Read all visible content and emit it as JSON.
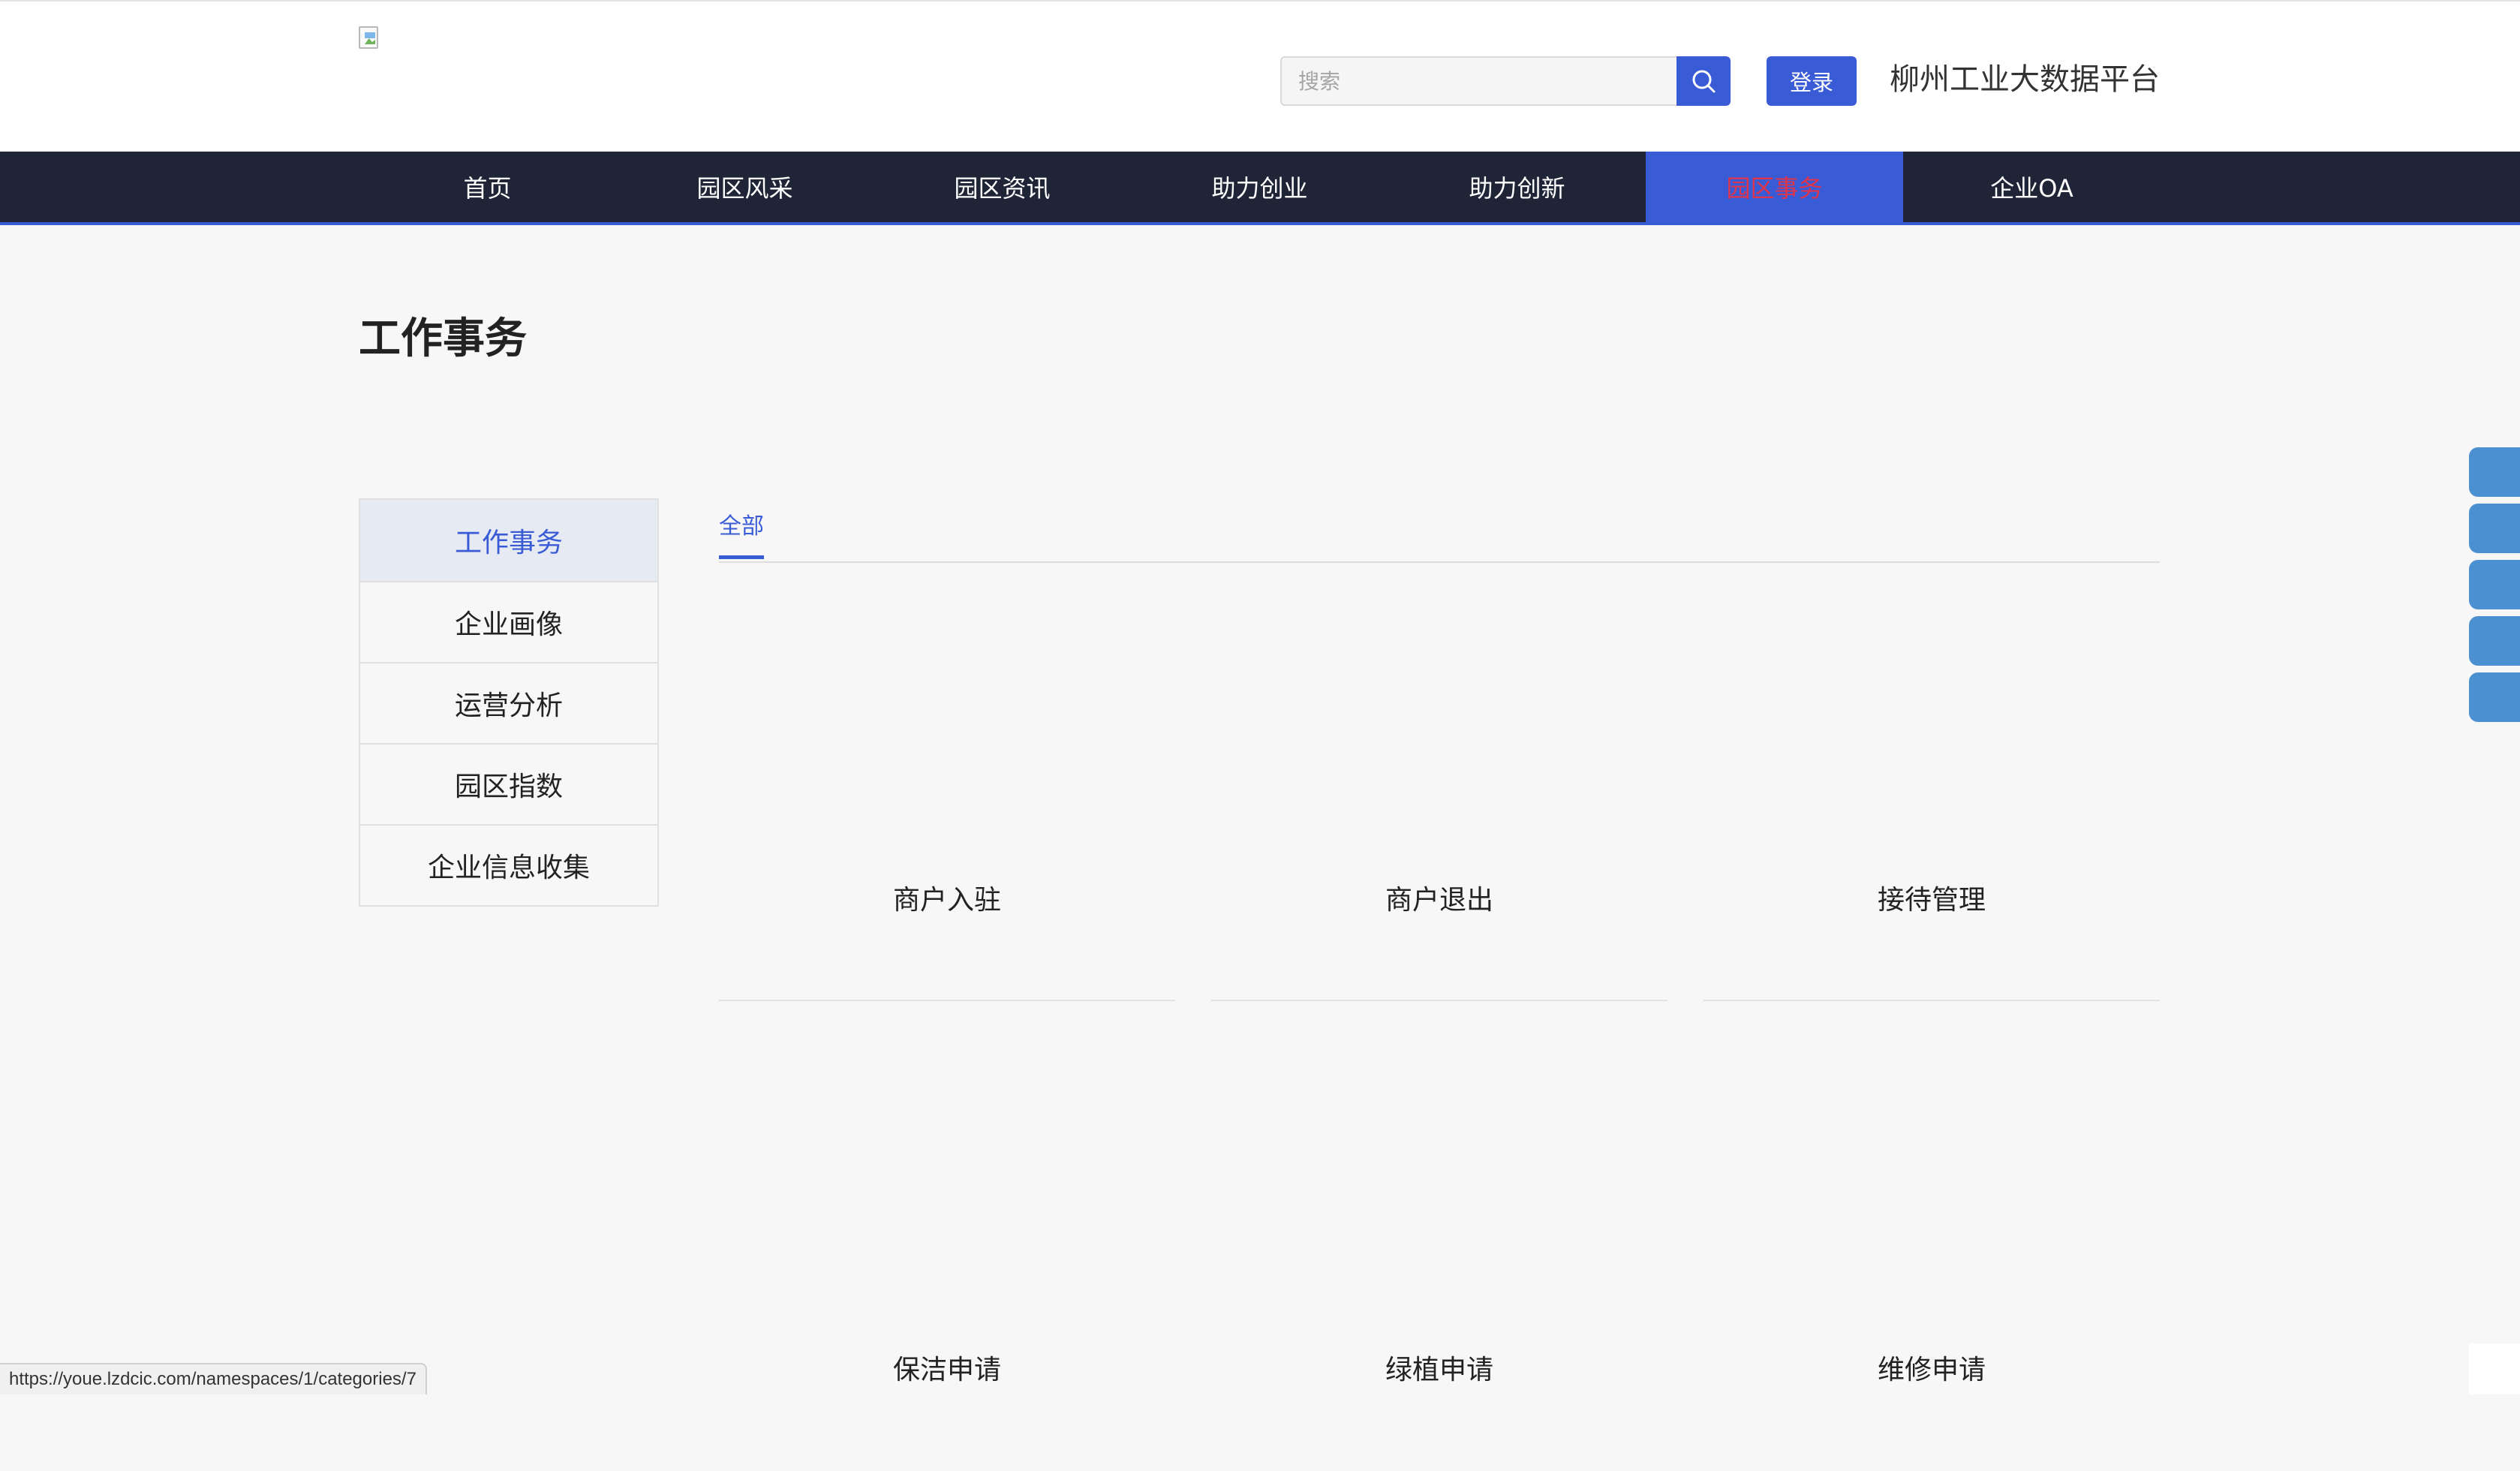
{
  "header": {
    "search_placeholder": "搜索",
    "login_label": "登录",
    "platform_title": "柳州工业大数据平台"
  },
  "nav": {
    "items": [
      {
        "label": "首页"
      },
      {
        "label": "园区风采"
      },
      {
        "label": "园区资讯"
      },
      {
        "label": "助力创业"
      },
      {
        "label": "助力创新"
      },
      {
        "label": "园区事务",
        "active": true
      },
      {
        "label": "企业OA"
      }
    ]
  },
  "page": {
    "title": "工作事务"
  },
  "sidebar": {
    "items": [
      {
        "label": "工作事务",
        "active": true
      },
      {
        "label": "企业画像"
      },
      {
        "label": "运营分析"
      },
      {
        "label": "园区指数"
      },
      {
        "label": "企业信息收集"
      }
    ]
  },
  "tabs": {
    "items": [
      {
        "label": "全部",
        "active": true
      }
    ]
  },
  "cards": [
    {
      "label": "商户入驻"
    },
    {
      "label": "商户退出"
    },
    {
      "label": "接待管理"
    },
    {
      "label": "保洁申请"
    },
    {
      "label": "绿植申请"
    },
    {
      "label": "维修申请"
    }
  ],
  "status_bar": {
    "url": "https://youe.lzdcic.com/namespaces/1/categories/7"
  },
  "colors": {
    "accent": "#3a5bd6",
    "nav_bg": "#1f2537",
    "active_nav_text": "#e0344a",
    "float_button": "#4b90d1"
  }
}
